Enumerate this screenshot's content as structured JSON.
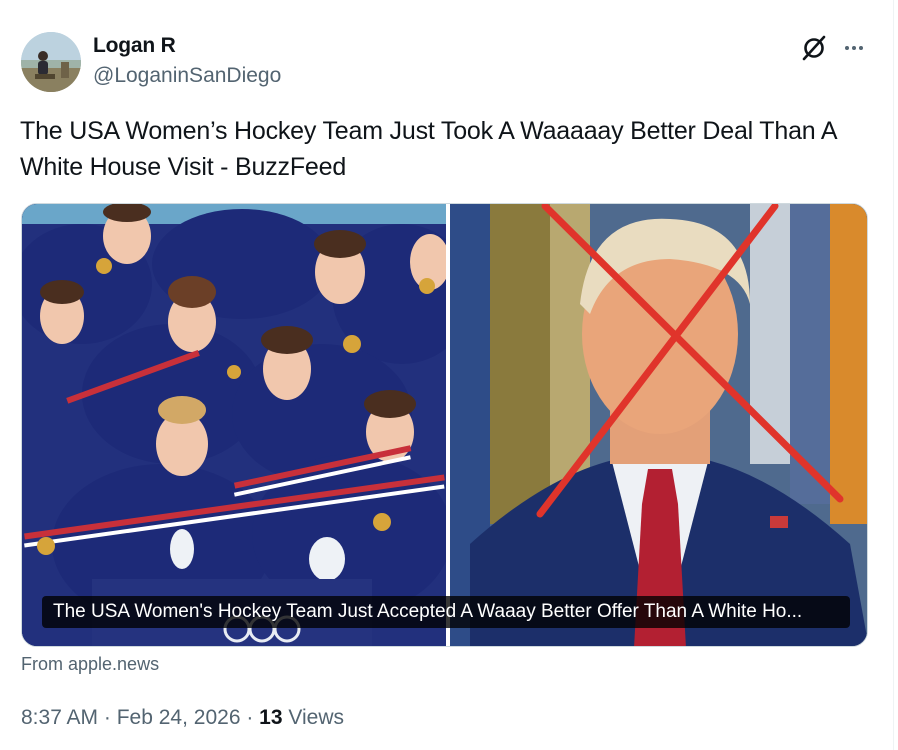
{
  "author": {
    "display_name": "Logan R",
    "handle": "@LoganinSanDiego",
    "avatar_icon": "profile-photo"
  },
  "header_icons": {
    "grok": "grok-icon",
    "more": "more-options-icon"
  },
  "tweet": {
    "text": "The USA Women’s Hockey Team Just Took A Waaaaay Better Deal Than A White House Visit - BuzzFeed"
  },
  "link_card": {
    "caption": "The USA Women's Hockey Team Just Accepted A Waaay Better Offer Than A White Ho...",
    "source_prefix": "From ",
    "source_domain": "apple.news"
  },
  "meta": {
    "time": "8:37 AM",
    "separator1": " · ",
    "date": "Feb 24, 2026",
    "separator2": " · ",
    "views_count": "13",
    "views_label": " Views"
  },
  "colors": {
    "text_primary": "#0f1419",
    "text_secondary": "#536471",
    "border": "#cfd9de",
    "team_jersey": "#1f2d7a",
    "red_x": "#e0342b"
  }
}
